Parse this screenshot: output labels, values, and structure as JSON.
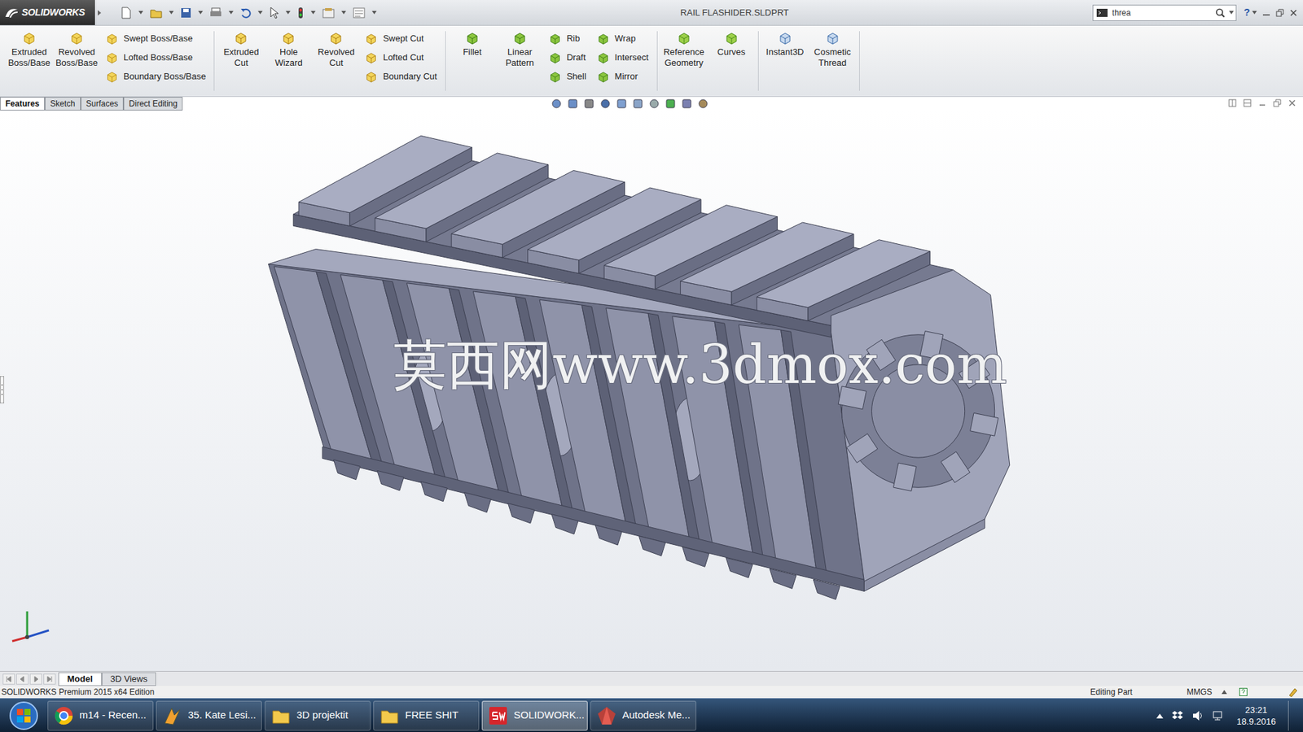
{
  "window": {
    "title": "RAIL FLASHIDER.SLDPRT",
    "help": "?"
  },
  "logo": {
    "text": "SOLIDWORKS"
  },
  "search": {
    "value": "threa"
  },
  "ribbon": [
    {
      "blocks": [
        {
          "kind": "large",
          "items": [
            "Extruded Boss/Base",
            "Revolved Boss/Base"
          ]
        },
        {
          "kind": "stack",
          "items": [
            "Swept Boss/Base",
            "Lofted Boss/Base",
            "Boundary Boss/Base"
          ]
        }
      ]
    },
    {
      "blocks": [
        {
          "kind": "large",
          "items": [
            "Extruded Cut",
            "Hole Wizard",
            "Revolved Cut"
          ]
        },
        {
          "kind": "stack",
          "items": [
            "Swept Cut",
            "Lofted Cut",
            "Boundary Cut"
          ]
        }
      ]
    },
    {
      "blocks": [
        {
          "kind": "large",
          "items": [
            "Fillet",
            "Linear Pattern"
          ]
        },
        {
          "kind": "stack",
          "items": [
            "Rib",
            "Draft",
            "Shell"
          ]
        },
        {
          "kind": "stack",
          "items": [
            "Wrap",
            "Intersect",
            "Mirror"
          ]
        }
      ]
    },
    {
      "blocks": [
        {
          "kind": "large",
          "items": [
            "Reference Geometry",
            "Curves"
          ]
        }
      ]
    },
    {
      "blocks": [
        {
          "kind": "large",
          "items": [
            "Instant3D",
            "Cosmetic Thread"
          ]
        }
      ]
    }
  ],
  "tabs": [
    {
      "label": "Features",
      "selected": true
    },
    {
      "label": "Sketch",
      "selected": false
    },
    {
      "label": "Surfaces",
      "selected": false
    },
    {
      "label": "Direct Editing",
      "selected": false
    }
  ],
  "viewport": {
    "watermark": "莫西网www.3dmox.com"
  },
  "bottom_tabs": [
    {
      "label": "Model",
      "selected": true
    },
    {
      "label": "3D Views",
      "selected": false
    }
  ],
  "status_bar": {
    "edition": "SOLIDWORKS Premium 2015 x64 Edition",
    "mode": "Editing Part",
    "units": "MMGS"
  },
  "taskbar": {
    "items": [
      {
        "label": "m14 - Recen...",
        "selected": false
      },
      {
        "label": "35. Kate Lesi...",
        "selected": false
      },
      {
        "label": "3D projektit",
        "selected": false
      },
      {
        "label": "FREE SHIT",
        "selected": false
      },
      {
        "label": "SOLIDWORK...",
        "selected": true
      },
      {
        "label": "Autodesk Me...",
        "selected": false
      }
    ],
    "clock": {
      "time": "23:21",
      "date": "18.9.2016"
    }
  }
}
